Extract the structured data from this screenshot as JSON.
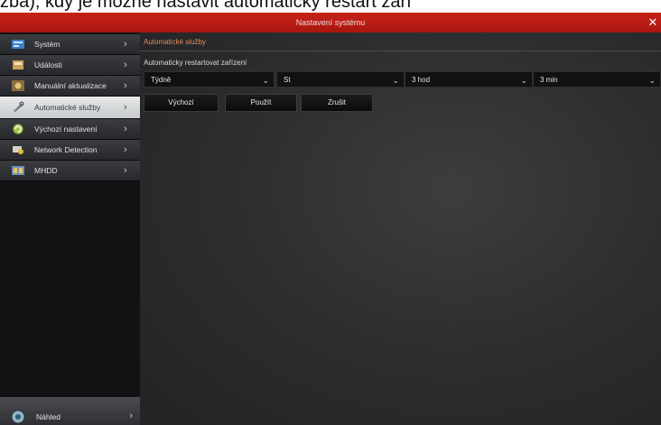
{
  "caption": "zba), kdy je možné nastavit automatický restart zaří",
  "window": {
    "title": "Nastavení systému",
    "close_icon": "close-icon"
  },
  "sidebar": {
    "items": [
      {
        "label": "Systém",
        "icon": "system-icon"
      },
      {
        "label": "Události",
        "icon": "events-icon"
      },
      {
        "label": "Manuální aktualizace",
        "icon": "upgrade-icon"
      },
      {
        "label": "Automatické služby",
        "icon": "wrench-icon",
        "active": true
      },
      {
        "label": "Výchozí nastavení",
        "icon": "reset-icon"
      },
      {
        "label": "Network Detection",
        "icon": "network-icon"
      },
      {
        "label": "MHDD",
        "icon": "disk-icon"
      }
    ],
    "preview": {
      "label": "Náhled",
      "icon": "preview-icon"
    }
  },
  "main": {
    "section_title": "Automatické služby",
    "field_label": "Automaticky restartovat zařízení",
    "selects": {
      "frequency": "Týdně",
      "day": "St",
      "hour": "3 hod",
      "minute": "3 min"
    },
    "buttons": {
      "default": "Výchozí",
      "apply": "Použít",
      "cancel": "Zrušit"
    }
  },
  "colors": {
    "titlebar": "#b81c14",
    "section_title": "#e88d5b",
    "active_item": "#dcdfe0"
  }
}
